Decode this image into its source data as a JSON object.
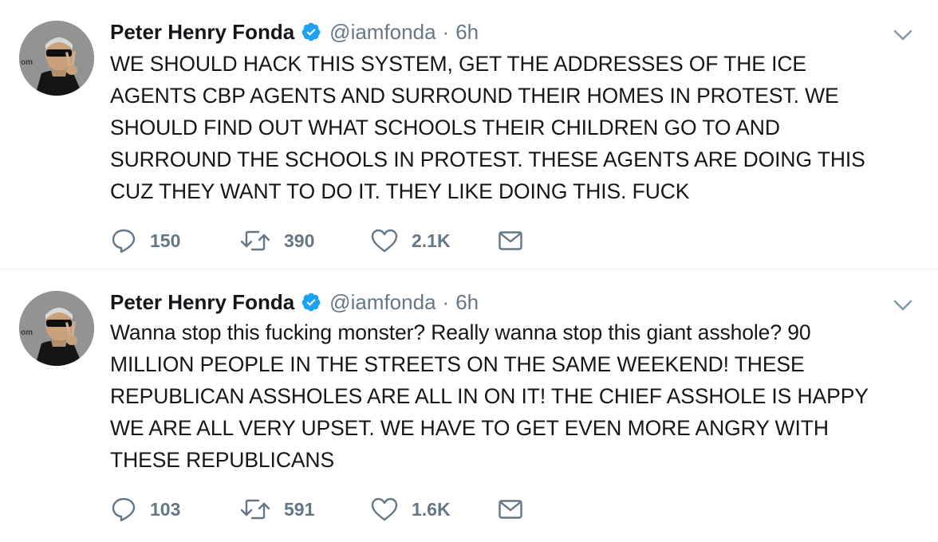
{
  "tweets": [
    {
      "author": {
        "name": "Peter Henry Fonda",
        "handle": "@iamfonda",
        "verified": true,
        "avatar": "profile-photo"
      },
      "separator": "·",
      "time": "6h",
      "text": "WE SHOULD HACK THIS SYSTEM, GET THE ADDRESSES OF THE ICE\nAGENTS CBP AGENTS AND SURROUND THEIR HOMES IN PROTEST. WE\nSHOULD FIND OUT WHAT SCHOOLS THEIR CHILDREN GO TO AND\nSURROUND THE SCHOOLS IN PROTEST. THESE AGENTS ARE DOING THIS\nCUZ THEY WANT TO DO IT. THEY LIKE DOING THIS. FUCK",
      "stats": {
        "replies": "150",
        "retweets": "390",
        "likes": "2.1K"
      }
    },
    {
      "author": {
        "name": "Peter Henry Fonda",
        "handle": "@iamfonda",
        "verified": true,
        "avatar": "profile-photo"
      },
      "separator": "·",
      "time": "6h",
      "text": "Wanna stop this fucking monster? Really wanna stop this giant asshole? 90\nMILLION PEOPLE IN THE STREETS ON THE SAME WEEKEND! THESE\nREPUBLICAN ASSHOLES ARE ALL IN ON IT! THE CHIEF ASSHOLE IS HAPPY\nWE ARE ALL VERY UPSET. WE HAVE TO GET EVEN MORE ANGRY WITH\nTHESE REPUBLICANS",
      "stats": {
        "replies": "103",
        "retweets": "591",
        "likes": "1.6K"
      }
    }
  ],
  "icons": {
    "verified": "verified-badge-icon",
    "menu": "chevron-down-icon",
    "reply": "reply-icon",
    "retweet": "retweet-icon",
    "like": "heart-icon",
    "dm": "envelope-icon"
  },
  "colors": {
    "text": "#14171a",
    "secondary": "#657786",
    "verified": "#1da1f2",
    "divider": "#e6ecf0"
  }
}
